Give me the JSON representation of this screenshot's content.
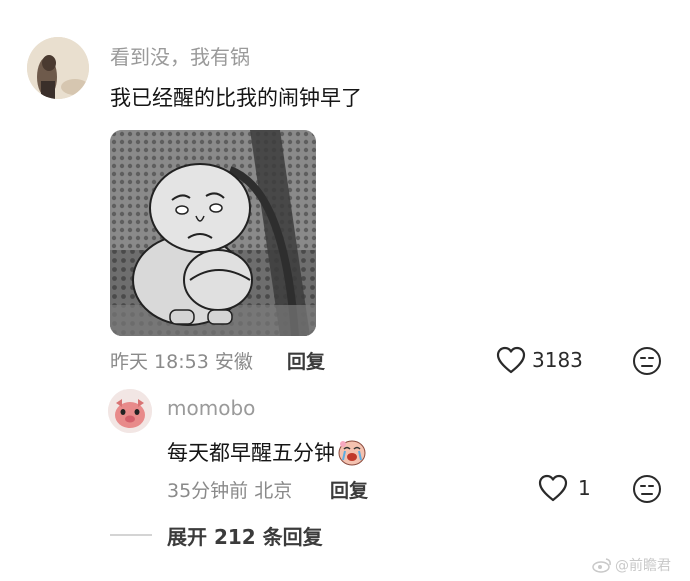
{
  "main_comment": {
    "username": "看到没，我有锅",
    "text": "我已经醒的比我的闹钟早了",
    "time": "昨天 18:53",
    "location": "安徽",
    "reply_label": "回复",
    "likes": "3183"
  },
  "reply_comment": {
    "username": "momobo",
    "text": "每天都早醒五分钟",
    "time": "35分钟前",
    "location": "北京",
    "reply_label": "回复",
    "likes": "1"
  },
  "expand_replies": "展开 212 条回复",
  "watermark": "@前瞻君",
  "colors": {
    "muted_text": "#9a9a9a",
    "primary_text": "#151515",
    "accent_text": "#3b3b3b"
  },
  "icons": [
    "heart-outline-icon",
    "emoji-face-icon",
    "crying-emoji-icon",
    "weibo-icon"
  ]
}
